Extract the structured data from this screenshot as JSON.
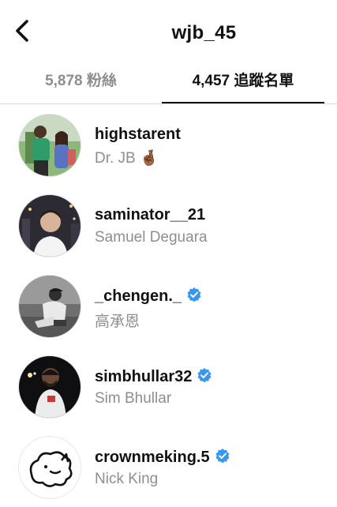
{
  "header": {
    "title": "wjb_45",
    "back_icon": "chevron-left-icon"
  },
  "tabs": {
    "followers": "5,878 粉絲",
    "following": "4,457 追蹤名單"
  },
  "accent_color": "#3897f0",
  "users": [
    {
      "username": "highstarent",
      "fullname": "Dr. JB",
      "emoji": "🤞🏾",
      "verified": false
    },
    {
      "username": "saminator__21",
      "fullname": "Samuel Deguara",
      "verified": false
    },
    {
      "username": "_chengen._",
      "fullname": "高承恩",
      "verified": true
    },
    {
      "username": "simbhullar32",
      "fullname": "Sim Bhullar",
      "verified": true
    },
    {
      "username": "crownmeking.5",
      "fullname": "Nick King",
      "verified": true
    }
  ]
}
